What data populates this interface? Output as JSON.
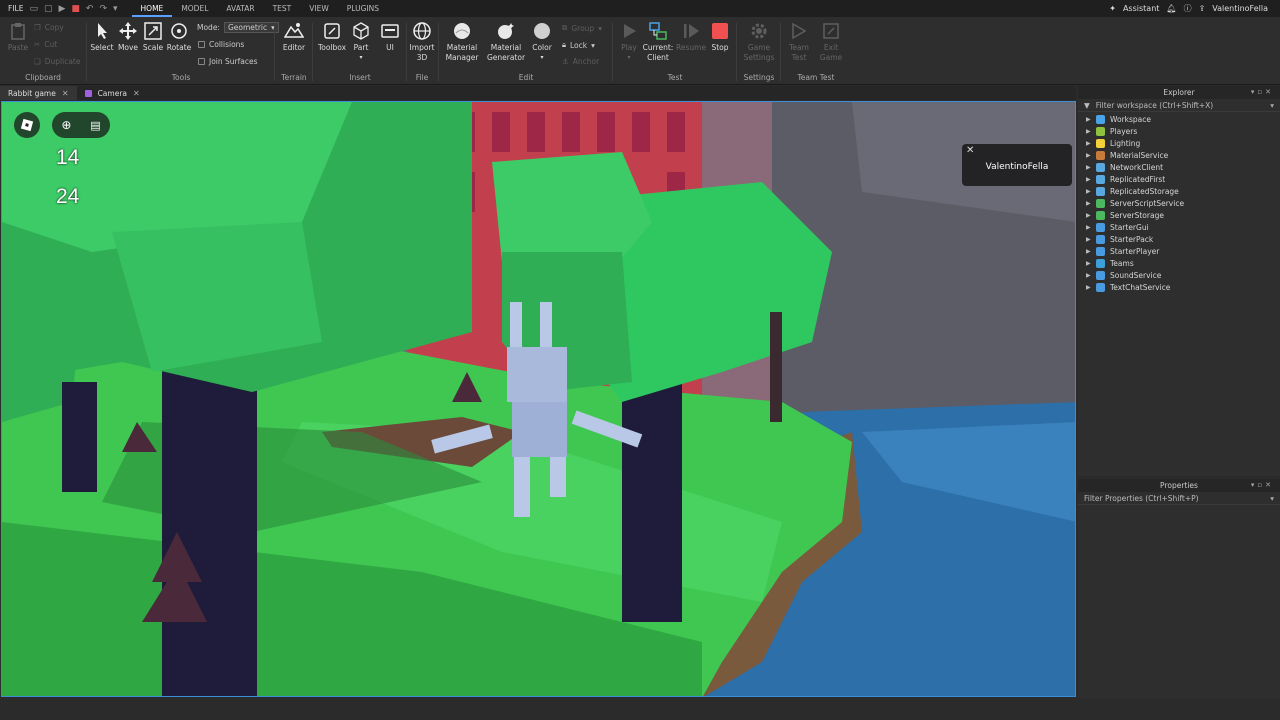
{
  "menu": {
    "file": "FILE",
    "tabs": [
      "HOME",
      "MODEL",
      "AVATAR",
      "TEST",
      "VIEW",
      "PLUGINS"
    ],
    "active": "HOME"
  },
  "account": {
    "assistant": "Assistant",
    "username": "ValentinoFella"
  },
  "ribbon": {
    "clipboard": {
      "label": "Clipboard",
      "paste": "Paste",
      "copy": "Copy",
      "cut": "Cut",
      "duplicate": "Duplicate"
    },
    "tools": {
      "label": "Tools",
      "select": "Select",
      "move": "Move",
      "scale": "Scale",
      "rotate": "Rotate",
      "mode_label": "Mode:",
      "mode_value": "Geometric",
      "collisions": "Collisions",
      "join_surfaces": "Join Surfaces"
    },
    "terrain": {
      "label": "Terrain",
      "editor": "Editor"
    },
    "insert": {
      "label": "Insert",
      "toolbox": "Toolbox",
      "part": "Part",
      "ui": "UI"
    },
    "file": {
      "label": "File",
      "import3d_1": "Import",
      "import3d_2": "3D"
    },
    "edit": {
      "label": "Edit",
      "material_manager_1": "Material",
      "material_manager_2": "Manager",
      "material_generator_1": "Material",
      "material_generator_2": "Generator",
      "color": "Color",
      "group": "Group",
      "lock": "Lock",
      "anchor": "Anchor"
    },
    "test": {
      "label": "Test",
      "play": "Play",
      "current_1": "Current:",
      "current_2": "Client",
      "resume": "Resume",
      "stop": "Stop"
    },
    "settings": {
      "label": "Settings",
      "game_settings_1": "Game",
      "game_settings_2": "Settings"
    },
    "team_test": {
      "label": "Team Test",
      "team_test_1": "Team",
      "team_test_2": "Test",
      "exit_game_1": "Exit",
      "exit_game_2": "Game"
    }
  },
  "doc_tabs": [
    "Rabbit game",
    "Camera"
  ],
  "viewport": {
    "counter_top": "14",
    "counter_bottom": "24",
    "player_name": "ValentinoFella"
  },
  "explorer": {
    "title": "Explorer",
    "filter": "Filter workspace (Ctrl+Shift+X)",
    "items": [
      {
        "name": "Workspace",
        "color": "#4aa3e8"
      },
      {
        "name": "Players",
        "color": "#8fc13e"
      },
      {
        "name": "Lighting",
        "color": "#f2d13a"
      },
      {
        "name": "MaterialService",
        "color": "#c67a3b"
      },
      {
        "name": "NetworkClient",
        "color": "#5aa8e0"
      },
      {
        "name": "ReplicatedFirst",
        "color": "#5aa8e0"
      },
      {
        "name": "ReplicatedStorage",
        "color": "#5aa8e0"
      },
      {
        "name": "ServerScriptService",
        "color": "#4cb860"
      },
      {
        "name": "ServerStorage",
        "color": "#4cb860"
      },
      {
        "name": "StarterGui",
        "color": "#4a9ae0"
      },
      {
        "name": "StarterPack",
        "color": "#4a9ae0"
      },
      {
        "name": "StarterPlayer",
        "color": "#4a9ae0"
      },
      {
        "name": "Teams",
        "color": "#3ea0d8"
      },
      {
        "name": "SoundService",
        "color": "#4a9ae0"
      },
      {
        "name": "TextChatService",
        "color": "#4a9ae0"
      }
    ]
  },
  "properties": {
    "title": "Properties",
    "filter": "Filter Properties (Ctrl+Shift+P)"
  }
}
